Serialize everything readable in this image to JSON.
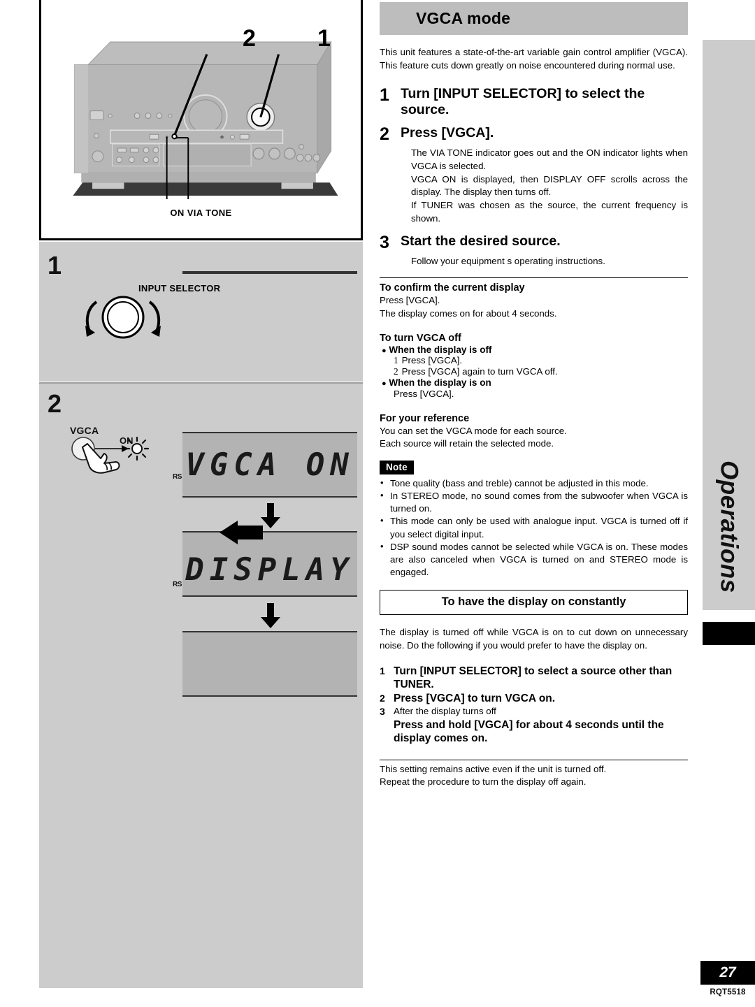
{
  "section": {
    "title": "VGCA mode",
    "intro": "This unit features a state-of-the-art variable gain control amplifier (VGCA). This feature cuts down greatly on noise encountered during normal use."
  },
  "steps": [
    {
      "number": "1",
      "heading": "Turn [INPUT SELECTOR] to select the source.",
      "body": []
    },
    {
      "number": "2",
      "heading": "Press [VGCA].",
      "body": [
        "The  VIA TONE  indicator goes out and the  ON  indicator lights when  VGCA  is selected.",
        " VGCA ON  is displayed, then  DISPLAY OFF  scrolls across the display. The display then turns off.",
        "If TUNER was chosen as the source, the current frequency is shown."
      ]
    },
    {
      "number": "3",
      "heading": "Start the desired source.",
      "body": [
        "Follow your equipment s operating instructions."
      ]
    }
  ],
  "subsections": {
    "confirm": {
      "heading": "To confirm the current display",
      "lines": [
        "Press [VGCA].",
        "The display comes on for about 4 seconds."
      ]
    },
    "turn_off": {
      "heading": "To turn VGCA off",
      "group_off_label": "When the display is off",
      "group_off_items": [
        {
          "index": "1",
          "text": "Press [VGCA]."
        },
        {
          "index": "2",
          "text": "Press [VGCA] again to turn VGCA off."
        }
      ],
      "group_on_label": "When the display is on",
      "group_on_text": "Press [VGCA]."
    },
    "reference": {
      "heading": "For your reference",
      "lines": [
        "You can set the VGCA mode for each source.",
        "Each source will retain the selected mode."
      ]
    }
  },
  "note": {
    "badge": "Note",
    "items": [
      "Tone quality (bass and treble) cannot be adjusted in this mode.",
      "In STEREO mode, no sound comes from the subwoofer when VGCA is turned on.",
      "This mode can only be used with analogue input. VGCA is turned off if you select digital input.",
      "DSP sound modes cannot be selected while VGCA is on. These modes are also canceled when VGCA is turned on and STEREO mode is engaged."
    ]
  },
  "display_constant": {
    "framed_title": "To have the display on constantly",
    "intro": "The display is turned off while VGCA is on to cut down on unnecessary noise. Do the following if you would prefer to have the display on.",
    "steps": [
      {
        "number": "1",
        "text": "Turn [INPUT SELECTOR] to select a source other than TUNER.",
        "bold": true
      },
      {
        "number": "2",
        "text": "Press [VGCA] to turn VGCA on.",
        "bold": true
      },
      {
        "number": "3",
        "text": "After the display turns off",
        "bold": false
      },
      {
        "number": "",
        "text": "Press and hold [VGCA] for about 4 seconds until the display comes on.",
        "bold": true
      }
    ],
    "footer_lines": [
      "This setting remains active even if the unit is turned off.",
      "Repeat the procedure to turn the display off again."
    ]
  },
  "illustration": {
    "callout_2": "2",
    "callout_1": "1",
    "indicator_labels": "ON  VIA TONE"
  },
  "left_steps": {
    "step1_number": "1",
    "step1_control_label": "INPUT SELECTOR",
    "step2_number": "2",
    "step2_button_label": "VGCA",
    "step2_indicator_label": "ON",
    "lcd1_text": "VGCA ON",
    "lcd1_side": "RS",
    "lcd2_text": "DISPLAY",
    "lcd2_side": "RS",
    "lcd3_text": ""
  },
  "sidebar": {
    "tab_label": "Operations"
  },
  "footer": {
    "page_number": "27",
    "doc_code": "RQT5518"
  },
  "colors": {
    "panel_gray": "#cccccc",
    "header_gray": "#bdbdbd",
    "lcd_gray": "#b3b3b3",
    "black": "#000000"
  }
}
